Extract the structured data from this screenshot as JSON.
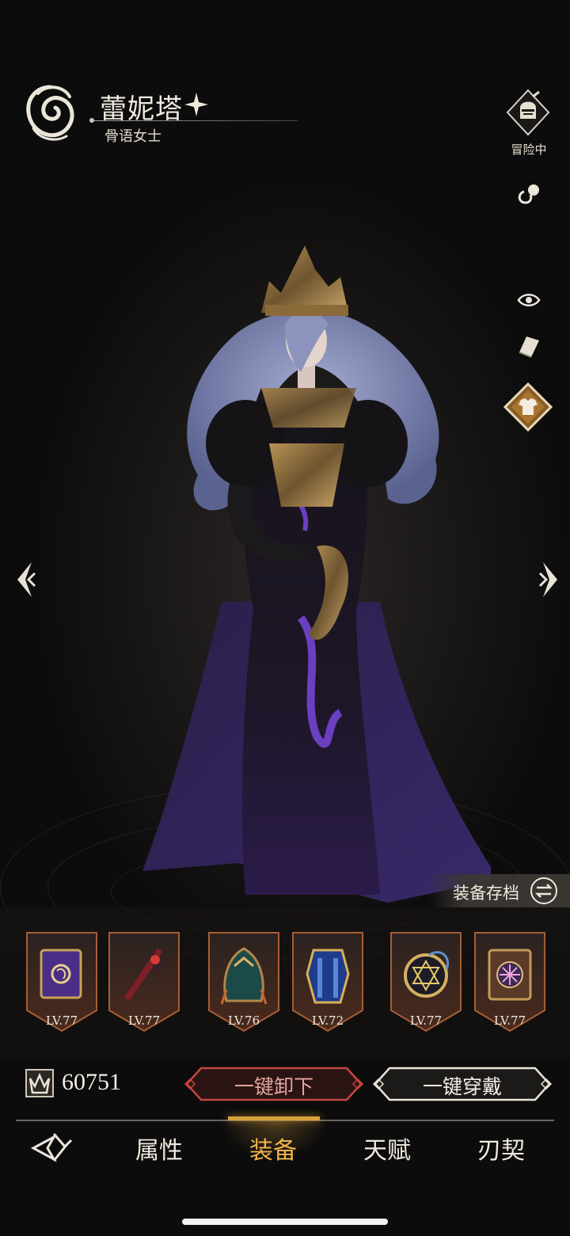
{
  "character": {
    "name": "蕾妮塔",
    "title": "骨语女士"
  },
  "status": {
    "adventure_label": "冒险中"
  },
  "archive": {
    "label": "装备存档"
  },
  "equipment": [
    {
      "slot": "tome",
      "level": "LV.77"
    },
    {
      "slot": "weapon",
      "level": "LV.77"
    },
    {
      "slot": "cloak",
      "level": "LV.76"
    },
    {
      "slot": "armor",
      "level": "LV.72"
    },
    {
      "slot": "amulet",
      "level": "LV.77"
    },
    {
      "slot": "relic-book",
      "level": "LV.77"
    }
  ],
  "power": {
    "value": "60751"
  },
  "actions": {
    "unequip_all": "一键卸下",
    "equip_all": "一键穿戴"
  },
  "nav": {
    "tabs": [
      "属性",
      "装备",
      "天赋",
      "刃契"
    ],
    "active_tab": "装备"
  },
  "colors": {
    "accent_gold": "#d7a13c",
    "active_tab_text": "#f0b44a",
    "unequip_red": "#c4463e",
    "dress_purple": "#4a2a78"
  },
  "icons": {
    "emblem": "swirl-emblem-icon",
    "rarity": "four-point-star-icon",
    "adventure": "knight-helmet-icon",
    "chat": "whistle-icon",
    "visibility": "eye-icon",
    "record": "book-icon",
    "outfit": "shirt-icon",
    "prev": "left-arrow-icon",
    "next": "right-arrow-icon",
    "swap": "swap-arrows-icon",
    "power": "crown-power-icon",
    "home": "blade-home-icon"
  }
}
